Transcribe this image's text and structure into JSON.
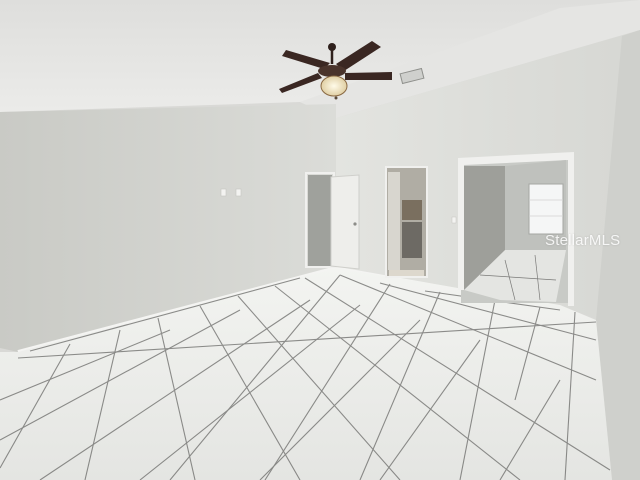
{
  "photo": {
    "watermark": "StellarMLS",
    "icons": [
      "ceiling-fan-icon"
    ],
    "colors": {
      "ceiling": "#e6e6e4",
      "wall_left": "#d3d4cf",
      "wall_right": "#e0e1dd",
      "floor": "#ecedea",
      "grout": "#5c5c5c",
      "door_dark": "#9fa19c",
      "fan_blade": "#3a2722",
      "fan_light": "#f2e9d2"
    }
  }
}
